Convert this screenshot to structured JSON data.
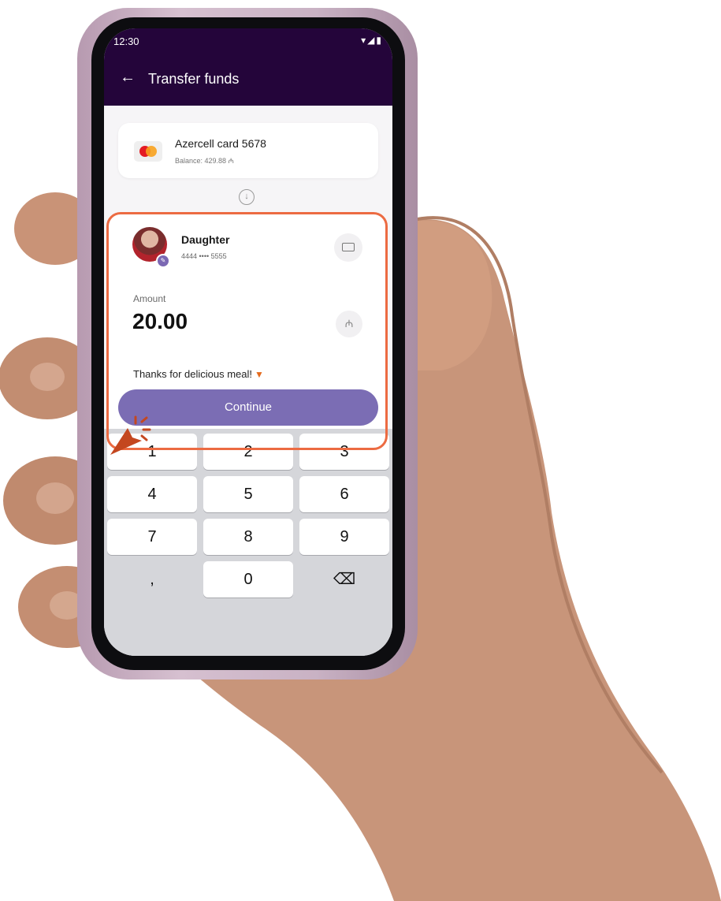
{
  "status_bar": {
    "time": "12:30",
    "icons": "▾◢▮"
  },
  "app_bar": {
    "title": "Transfer funds"
  },
  "source_card": {
    "name": "Azercell card 5678",
    "balance": "Balance: 429.88 ₼"
  },
  "recipient": {
    "name": "Daughter",
    "card_number": "4444 •••• 5555"
  },
  "amount": {
    "label": "Amount",
    "value": "20.00",
    "currency_symbol": "₼"
  },
  "note": {
    "text": "Thanks for delicious meal!",
    "emoji_icon": "pizza-icon"
  },
  "continue_button": {
    "label": "Continue"
  },
  "keypad": {
    "row1": [
      "1",
      "2",
      "3"
    ],
    "row2": [
      "4",
      "5",
      "6"
    ],
    "row3": [
      "7",
      "8",
      "9"
    ],
    "row4": [
      ",",
      "0",
      "⌫"
    ]
  },
  "colors": {
    "app_bar": "#24053a",
    "accent": "#7b6db4",
    "highlight": "#ec6b42",
    "keypad_bg": "#d5d6da"
  }
}
